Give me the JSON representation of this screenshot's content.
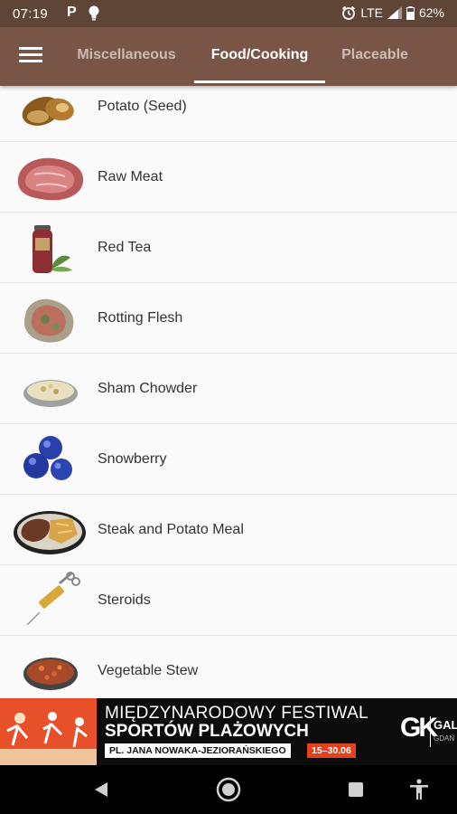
{
  "status_bar": {
    "time": "07:19",
    "notification_icons": [
      "parking-p-icon",
      "lightbulb-icon"
    ],
    "alarm_icon": "alarm-icon",
    "network": "LTE",
    "battery": "62%",
    "background_color": "#5e4537"
  },
  "app_bar": {
    "background_color": "#795548",
    "menu_icon": "hamburger-menu-icon",
    "tabs": [
      {
        "label": "Miscellaneous",
        "active": false
      },
      {
        "label": "Food/Cooking",
        "active": true
      },
      {
        "label": "Placeable",
        "active": false
      }
    ]
  },
  "items": [
    {
      "name": "Potato (Seed)",
      "icon": "potato-seed-icon"
    },
    {
      "name": "Raw Meat",
      "icon": "raw-meat-icon"
    },
    {
      "name": "Red Tea",
      "icon": "red-tea-jar-icon"
    },
    {
      "name": "Rotting Flesh",
      "icon": "rotting-flesh-icon"
    },
    {
      "name": "Sham Chowder",
      "icon": "chowder-bowl-icon"
    },
    {
      "name": "Snowberry",
      "icon": "snowberry-icon"
    },
    {
      "name": "Steak and Potato Meal",
      "icon": "steak-plate-icon"
    },
    {
      "name": "Steroids",
      "icon": "syringe-icon"
    },
    {
      "name": "Vegetable Stew",
      "icon": "stew-bowl-icon"
    }
  ],
  "ad_banner": {
    "line1": "MIĘDZYNARODOWY FESTIWAL",
    "line2": "SPORTÓW PLAŻOWYCH",
    "location": "PL. JANA NOWAKA-JEZIORAŃSKIEGO",
    "dates": "15–30.06",
    "logo_mark": "GK",
    "logo_text": "GAL",
    "logo_sub": "GDAŃ"
  },
  "nav_bar": {
    "buttons": [
      "back-icon",
      "home-icon",
      "recents-icon",
      "accessibility-icon"
    ]
  }
}
